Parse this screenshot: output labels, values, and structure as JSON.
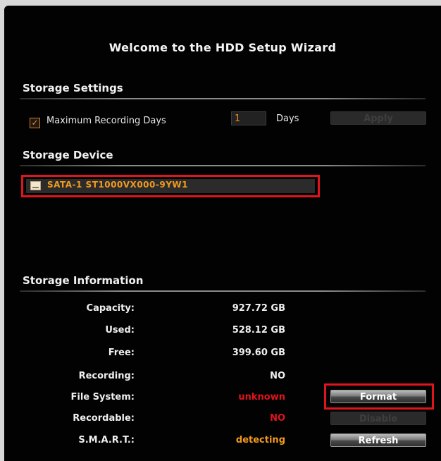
{
  "wizard": {
    "title": "Welcome to the HDD Setup Wizard"
  },
  "storage_settings": {
    "heading": "Storage Settings",
    "max_days_label": "Maximum Recording Days",
    "max_days_checked": true,
    "days_value": "1",
    "days_unit": "Days",
    "apply_label": "Apply"
  },
  "storage_device": {
    "heading": "Storage Device",
    "devices": [
      {
        "label": "SATA-1 ST1000VX000-9YW1",
        "selected": true
      }
    ]
  },
  "storage_info": {
    "heading": "Storage Information",
    "capacity_label": "Capacity:",
    "capacity_value": "927.72 GB",
    "used_label": "Used:",
    "used_value": "528.12 GB",
    "free_label": "Free:",
    "free_value": "399.60 GB",
    "recording_label": "Recording:",
    "recording_value": "NO",
    "filesystem_label": "File System:",
    "filesystem_value": "unknown",
    "recordable_label": "Recordable:",
    "recordable_value": "NO",
    "smart_label": "S.M.A.R.T.:",
    "smart_value": "detecting",
    "format_label": "Format",
    "disable_label": "Disable",
    "refresh_label": "Refresh"
  },
  "colors": {
    "background": "#020202",
    "accent_orange": "#f29a1e",
    "alert_red": "#e0141c",
    "highlight_box": "#e0141c"
  },
  "icons": {
    "checkbox": "check-icon",
    "device": "hard-drive-icon"
  }
}
